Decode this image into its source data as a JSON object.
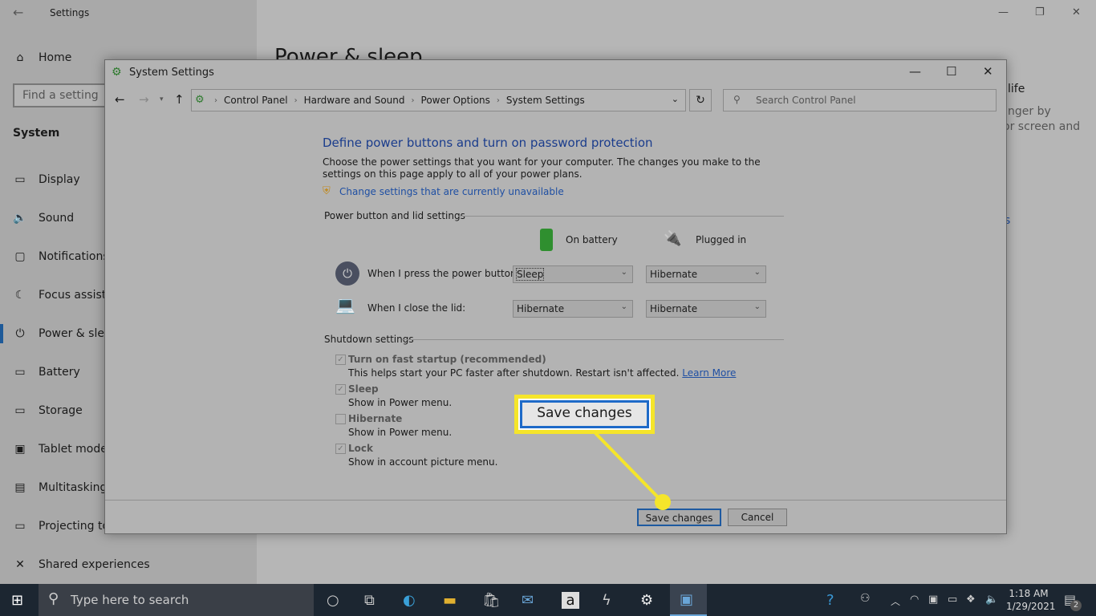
{
  "settings": {
    "title": "Settings",
    "home": "Home",
    "find_placeholder": "Find a setting",
    "section": "System",
    "nav": [
      {
        "icon": "display-icon",
        "label": "Display",
        "glyph": "▭"
      },
      {
        "icon": "sound-icon",
        "label": "Sound",
        "glyph": "🔈"
      },
      {
        "icon": "notifications-icon",
        "label": "Notifications & actions",
        "glyph": "▢"
      },
      {
        "icon": "focus-assist-icon",
        "label": "Focus assist",
        "glyph": "☾"
      },
      {
        "icon": "power-icon",
        "label": "Power & sleep",
        "glyph": "⏻"
      },
      {
        "icon": "battery-icon",
        "label": "Battery",
        "glyph": "▭"
      },
      {
        "icon": "storage-icon",
        "label": "Storage",
        "glyph": "▭"
      },
      {
        "icon": "tablet-mode-icon",
        "label": "Tablet mode",
        "glyph": "▣"
      },
      {
        "icon": "multitasking-icon",
        "label": "Multitasking",
        "glyph": "▤"
      },
      {
        "icon": "projecting-icon",
        "label": "Projecting to this PC",
        "glyph": "▭"
      },
      {
        "icon": "shared-experiences-icon",
        "label": "Shared experiences",
        "glyph": "✕"
      }
    ],
    "page_title": "Power & sleep",
    "right_fragments": [
      "life",
      "nger by",
      "or screen and",
      "s"
    ]
  },
  "dialog": {
    "title": "System Settings",
    "breadcrumb": [
      "Control Panel",
      "Hardware and Sound",
      "Power Options",
      "System Settings"
    ],
    "search_placeholder": "Search Control Panel",
    "heading": "Define power buttons and turn on password protection",
    "description": "Choose the power settings that you want for your computer. The changes you make to the settings on this page apply to all of your power plans.",
    "change_link": "Change settings that are currently unavailable",
    "power_section": "Power button and lid settings",
    "col_battery": "On battery",
    "col_plugged": "Plugged in",
    "rows": [
      {
        "label": "When I press the power button:",
        "battery": "Sleep",
        "plugged": "Hibernate"
      },
      {
        "label": "When I close the lid:",
        "battery": "Hibernate",
        "plugged": "Hibernate"
      }
    ],
    "shutdown_section": "Shutdown settings",
    "options": [
      {
        "label": "Turn on fast startup (recommended)",
        "desc": "This helps start your PC faster after shutdown. Restart isn't affected.",
        "link": "Learn More",
        "checked": true
      },
      {
        "label": "Sleep",
        "desc": "Show in Power menu.",
        "checked": true
      },
      {
        "label": "Hibernate",
        "desc": "Show in Power menu.",
        "checked": false
      },
      {
        "label": "Lock",
        "desc": "Show in account picture menu.",
        "checked": true
      }
    ],
    "save": "Save changes",
    "cancel": "Cancel",
    "callout": "Save changes",
    "callout_color": "#f5e52a"
  },
  "taskbar": {
    "search_placeholder": "Type here to search",
    "time": "1:18 AM",
    "date": "1/29/2021",
    "notification_count": "2"
  }
}
